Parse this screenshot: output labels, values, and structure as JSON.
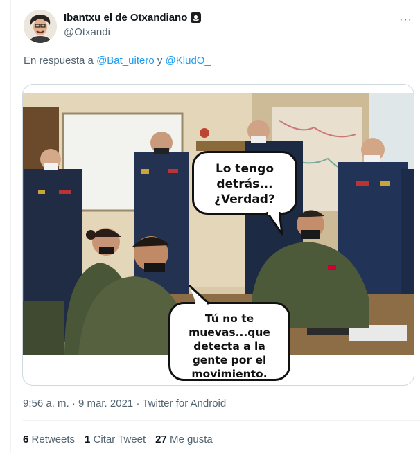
{
  "tweet": {
    "author": {
      "display_name": "Ibantxu el de Otxandiano",
      "handle": "@Otxandi",
      "badge_icon": "skull-crossbones-icon"
    },
    "more_icon": "more-options-icon",
    "reply": {
      "prefix": "En respuesta a",
      "mention_1": "@Bat_uitero",
      "conjunction": "y",
      "mention_2": "@KludO_"
    },
    "meme": {
      "bubble_top": [
        "Lo tengo",
        "detrás...",
        "¿Verdad?"
      ],
      "bubble_bottom": [
        "Tú no te",
        "muevas...que",
        "detecta a la",
        "gente por el",
        "movimiento."
      ]
    },
    "meta": {
      "time": "9:56 a. m.",
      "separator_1": "·",
      "date": "9 mar. 2021",
      "separator_2": "·",
      "source": "Twitter for Android"
    },
    "stats": {
      "retweets_count": "6",
      "retweets_label": "Retweets",
      "quotes_count": "1",
      "quotes_label": "Citar Tweet",
      "likes_count": "27",
      "likes_label": "Me gusta"
    }
  },
  "colors": {
    "accent": "#1d9bf0",
    "secondary_text": "#536471",
    "primary_text": "#0f1419",
    "border": "#cfd9de"
  }
}
